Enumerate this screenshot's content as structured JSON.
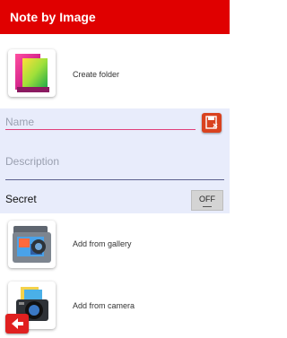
{
  "app": {
    "title": "Note by Image"
  },
  "actions": {
    "create_folder": "Create folder",
    "add_from_gallery": "Add from gallery",
    "add_from_camera": "Add from camera"
  },
  "form": {
    "name_placeholder": "Name",
    "description_placeholder": "Description",
    "secret_label": "Secret",
    "secret_toggle": "OFF"
  },
  "icons": {
    "folder": "folder-icon",
    "save": "save-icon",
    "gallery": "gallery-icon",
    "camera": "camera-icon",
    "back": "back-arrow-icon"
  },
  "colors": {
    "app_bar": "#e00000",
    "form_background": "#e8ecfb",
    "name_underline": "#e0407a",
    "save_button": "#d9421f",
    "back_button": "#e02020"
  }
}
